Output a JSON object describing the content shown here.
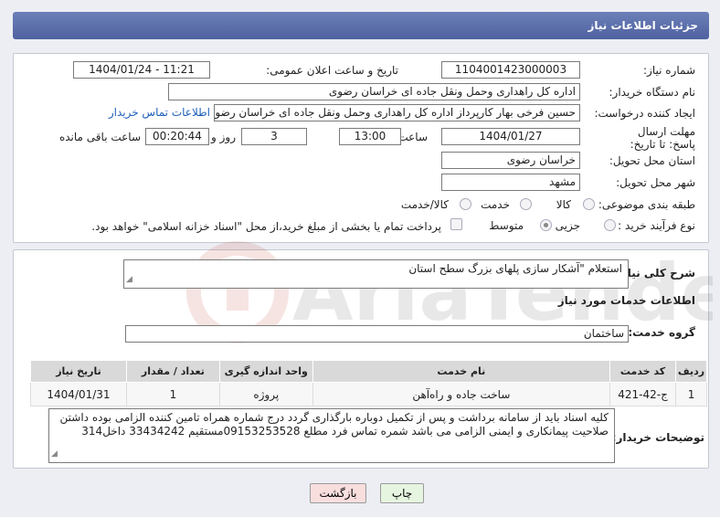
{
  "header": {
    "title": "جزئیات اطلاعات نیاز"
  },
  "labels": {
    "need_number": "شماره نیاز:",
    "announce_datetime": "تاریخ و ساعت اعلان عمومی:",
    "buyer_org": "نام دستگاه خریدار:",
    "requester": "ایجاد کننده درخواست:",
    "deadline": "مهلت ارسال پاسخ: تا تاریخ:",
    "time": "ساعت",
    "day_and": "روز و",
    "remaining": "ساعت باقی مانده",
    "province": "استان محل تحویل:",
    "city": "شهر محل تحویل:",
    "category": "طبقه بندی موضوعی:",
    "process_type": "نوع فرآیند خرید :",
    "general_desc": "شرح کلی نیاز:",
    "services_info": "اطلاعات خدمات مورد نیاز",
    "service_group": "گروه خدمت:",
    "buyer_notes": "توضیحات خریدار:"
  },
  "fields": {
    "need_number": "1104001423000003",
    "announce_datetime": "1404/01/24 - 11:21",
    "buyer_org": "اداره کل راهداری وحمل ونقل جاده ای خراسان رضوی",
    "requester": "حسین فرخی بهار کارپرداز اداره کل راهداری وحمل ونقل جاده ای خراسان رضوی",
    "deadline_date": "1404/01/27",
    "deadline_time": "13:00",
    "days": "3",
    "remaining_time": "00:20:44",
    "province": "خراسان رضوی",
    "city": "مشهد",
    "general_desc": "استعلام \"آشکار سازی پلهای بزرگ سطح استان",
    "service_group": "ساختمان",
    "buyer_notes": "کلیه اسناد باید از سامانه برداشت و پس از تکمیل دوباره بارگذاری گردد درج شماره همراه تامین کننده الزامی بوده داشتن صلاحیت پیمانکاری و ایمنی الزامی می باشد  شمره تماس فرد مطلع  09153253528مستقیم 33434242 داخل314"
  },
  "contact_link": "اطلاعات تماس خریدار",
  "category_options": [
    {
      "label": "کالا",
      "selected": false
    },
    {
      "label": "خدمت",
      "selected": false
    },
    {
      "label": "کالا/خدمت",
      "selected": false
    }
  ],
  "process_options": [
    {
      "label": "جزیی",
      "selected": false
    },
    {
      "label": "متوسط",
      "selected": true
    }
  ],
  "payment_note": "پرداخت تمام یا بخشی از مبلغ خرید،از محل \"اسناد خزانه اسلامی\" خواهد بود.",
  "table": {
    "headers": [
      "ردیف",
      "کد خدمت",
      "نام خدمت",
      "واحد اندازه گیری",
      "تعداد / مقدار",
      "تاریخ نیاز"
    ],
    "rows": [
      [
        "1",
        "ج-42-421",
        "ساخت جاده و راه‌آهن",
        "پروژه",
        "1",
        "1404/01/31"
      ]
    ]
  },
  "buttons": {
    "print": "چاپ",
    "back": "بازگشت"
  },
  "watermark": {
    "text": "AriaTender.neT"
  },
  "colors": {
    "header": "#5a6dab",
    "back_button": "#f9dede",
    "print_button": "#e6f5e0",
    "link": "#1f5fb8"
  }
}
